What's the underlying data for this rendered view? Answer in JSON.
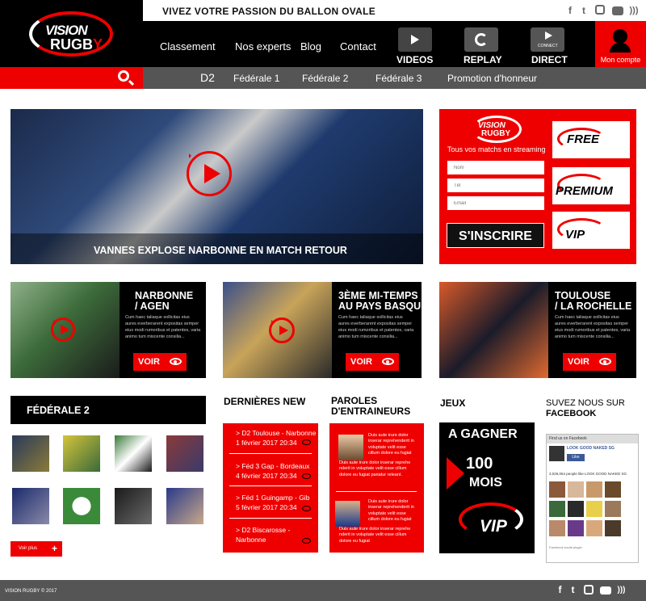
{
  "header": {
    "logo_line1": "VISION",
    "logo_line2a": "RUGB",
    "logo_line2b": "Y",
    "tagline": "VIVEZ VOTRE  PASSION DU BALLON OVALE",
    "social": [
      "facebook-icon",
      "twitter-icon",
      "instagram-icon",
      "youtube-icon",
      "rss-icon"
    ],
    "nav": [
      "Classement",
      "Nos experts",
      "Blog",
      "Contact"
    ],
    "media": [
      "VIDEOS",
      "REPLAY",
      "DIRECT"
    ],
    "media_connect": "CONNECT",
    "account": "Mon compte"
  },
  "subnav": [
    "D2",
    "Fédérale 1",
    "Fédérale 2",
    "Fédérale 3",
    "Promotion d'honneur"
  ],
  "hero": {
    "title": "VANNES EXPLOSE NARBONNE EN MATCH RETOUR"
  },
  "signup": {
    "logo_line1": "VISION",
    "logo_line2": "RUGBY",
    "tagline": "Tous vos matchs en streaming",
    "name_placeholder": "Nom",
    "tel_placeholder": "Tél",
    "email_placeholder": "Email",
    "button": "S'INSCRIRE",
    "offers": [
      "FREE",
      "PREMIUM",
      "VIP"
    ]
  },
  "cards": [
    {
      "title1": "NARBONNE",
      "title2": "/ AGEN",
      "text": "Cum haec taliaque sollicitas eius aures everberarent expositas semper eius modi rumoribus et patentes, varia animo tum miscente consilia...",
      "voir": "VOIR"
    },
    {
      "title1": "3ÈME MI-TEMPS",
      "title2": "AU PAYS BASQUE",
      "text": "Cum haec taliaque sollicitas eius aures everberarent expositas semper eius modi rumoribus et patentes, varia animo tum miscente consilia...",
      "voir": "VOIR"
    },
    {
      "title1": "TOULOUSE",
      "title2": "/ LA ROCHELLE",
      "text": "Cum haec taliaque sollicitas eius aures everberarent expositas semper eius modi rumoribus et patentes, varia animo tum miscente consilia...",
      "voir": "VOIR"
    }
  ],
  "federale": {
    "title": "FÉDÉRALE 2",
    "voir_plus": "Voir plus",
    "plus": "+"
  },
  "news": {
    "title": "DERNIÈRES NEW",
    "items": [
      {
        "line1": "> D2 Toulouse - Narbonne",
        "line2": "1 février 2017 20:34"
      },
      {
        "line1": "> Féd 3 Gap - Bordeaux",
        "line2": "4 février 2017 20:34"
      },
      {
        "line1": "> Féd 1 Guingamp - Gib",
        "line2": "5 février 2017 20:34"
      },
      {
        "line1": "> D2  Biscarosse -",
        "line2": "Narbonne"
      }
    ]
  },
  "coaches": {
    "title1": "PAROLES",
    "title2": "D'ENTRAINEURS",
    "quote1": "Duis aute irure dolor inserar reprehenderit in voluptate velit esse cillum dolore eu fugiat",
    "quote1b": "Duis aute irure dolor inserar reprehe nderit in voluptate velit esse cillum dolore eu fugiat pariatur releant.",
    "quote2": "Duis aute irure dolor inserar reprehenderit in voluptate velit esse cillum dolore eu fugiat",
    "quote2b": "Duis aute irure dolor inserar reprehe nderit in voluptate velit esse cillum dolore eu fugiat"
  },
  "jeux": {
    "title": "JEUX",
    "line1": "A GAGNER",
    "line2": "100",
    "line3": "MOIS",
    "vip": "VIP"
  },
  "facebook": {
    "title1": "SUVEZ NOUS SUR",
    "title2": "FACEBOOK",
    "header": "Find us on Facebook",
    "page": "LOOK GOOD NAKED SG",
    "like": "Like",
    "count": "3,026,064 people like LOOK GOOD NAKED SG",
    "plugin": "Facebook social plugin"
  },
  "footer": {
    "copy": "VISION RUGBY © 2017"
  },
  "colors": {
    "accent": "#e00000",
    "dark": "#000000",
    "gray": "#555555"
  }
}
